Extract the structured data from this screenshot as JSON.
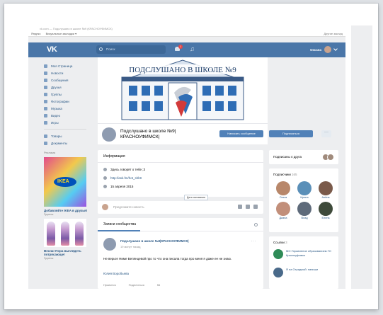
{
  "browser": {
    "address": "vk.com — Подслушано в школе №9 (КРАСНОУФИМСК)",
    "bookmarks": [
      "Яндекс",
      "Визуальные закладки ▾"
    ],
    "right": "Другие заклад"
  },
  "topbar": {
    "logo": "VK",
    "search_placeholder": "Поиск",
    "notif_count": "1",
    "user_name": "Оксана"
  },
  "sidebar": {
    "items": [
      {
        "label": "Моя Страница"
      },
      {
        "label": "Новости"
      },
      {
        "label": "Сообщения"
      },
      {
        "label": "Друзья"
      },
      {
        "label": "Группы"
      },
      {
        "label": "Фотографии"
      },
      {
        "label": "Музыка"
      },
      {
        "label": "Видео"
      },
      {
        "label": "Игры"
      }
    ],
    "items2": [
      {
        "label": "Товары"
      },
      {
        "label": "Документы"
      }
    ],
    "ads_label": "Реклама",
    "ad1": {
      "title": "Добавляйте IKEA в друзья!",
      "sub": "Группы"
    },
    "ad2": {
      "title": "Весна! Пора выглядеть потрясающе!",
      "sub": "Группы"
    }
  },
  "cover": {
    "title": "ПОДСЛУШАНО В ШКОЛЕ №9"
  },
  "group": {
    "name": "Подслушано в школе №9| КРАСНОУФИМСК|",
    "btn_message": "Написать сообщение",
    "btn_subscribe": "Подписаться",
    "btn_more": "···"
  },
  "info": {
    "title": "Информация",
    "rows": [
      {
        "text": "Здесь говорят о тебе ;3"
      },
      {
        "text": "http://ask.fm/hot_shk9"
      },
      {
        "text": "15 апреля 2015"
      }
    ],
    "tooltip": "Дата основания"
  },
  "compose": {
    "placeholder": "Предложите новость"
  },
  "wall": {
    "tab": "Записи сообщества",
    "post": {
      "author": "Подслушано в школе №9|КРАСНОУФИМСК|",
      "date": "19 минут назад",
      "text": "Не верьте Ниме Белянцевой про то что она писала тогда про меня я даже ее не знаю.",
      "signature": "Юлия Воробьева",
      "actions": [
        "Нравится",
        "Поделиться",
        "56"
      ]
    }
  },
  "right": {
    "friends_sub": "Подписаны 4 друга",
    "members_title": "Подписчики",
    "members_count": "165",
    "members": [
      {
        "name": "Ольга",
        "color": "#b8876a"
      },
      {
        "name": "Ирина",
        "color": "#5a8fb8"
      },
      {
        "name": "Алёна",
        "color": "#7a5a4a"
      },
      {
        "name": "Диана",
        "color": "#c28f7a"
      },
      {
        "name": "Влад",
        "color": "#5e6a7a"
      },
      {
        "name": "Елена",
        "color": "#3e4a3a"
      }
    ],
    "links_title": "Ссылки",
    "links_count": "3",
    "links": [
      {
        "text": "МО Управление образованием ГО Красноуфимск"
      },
      {
        "text": "Я на Отрадный: напиши"
      }
    ]
  }
}
